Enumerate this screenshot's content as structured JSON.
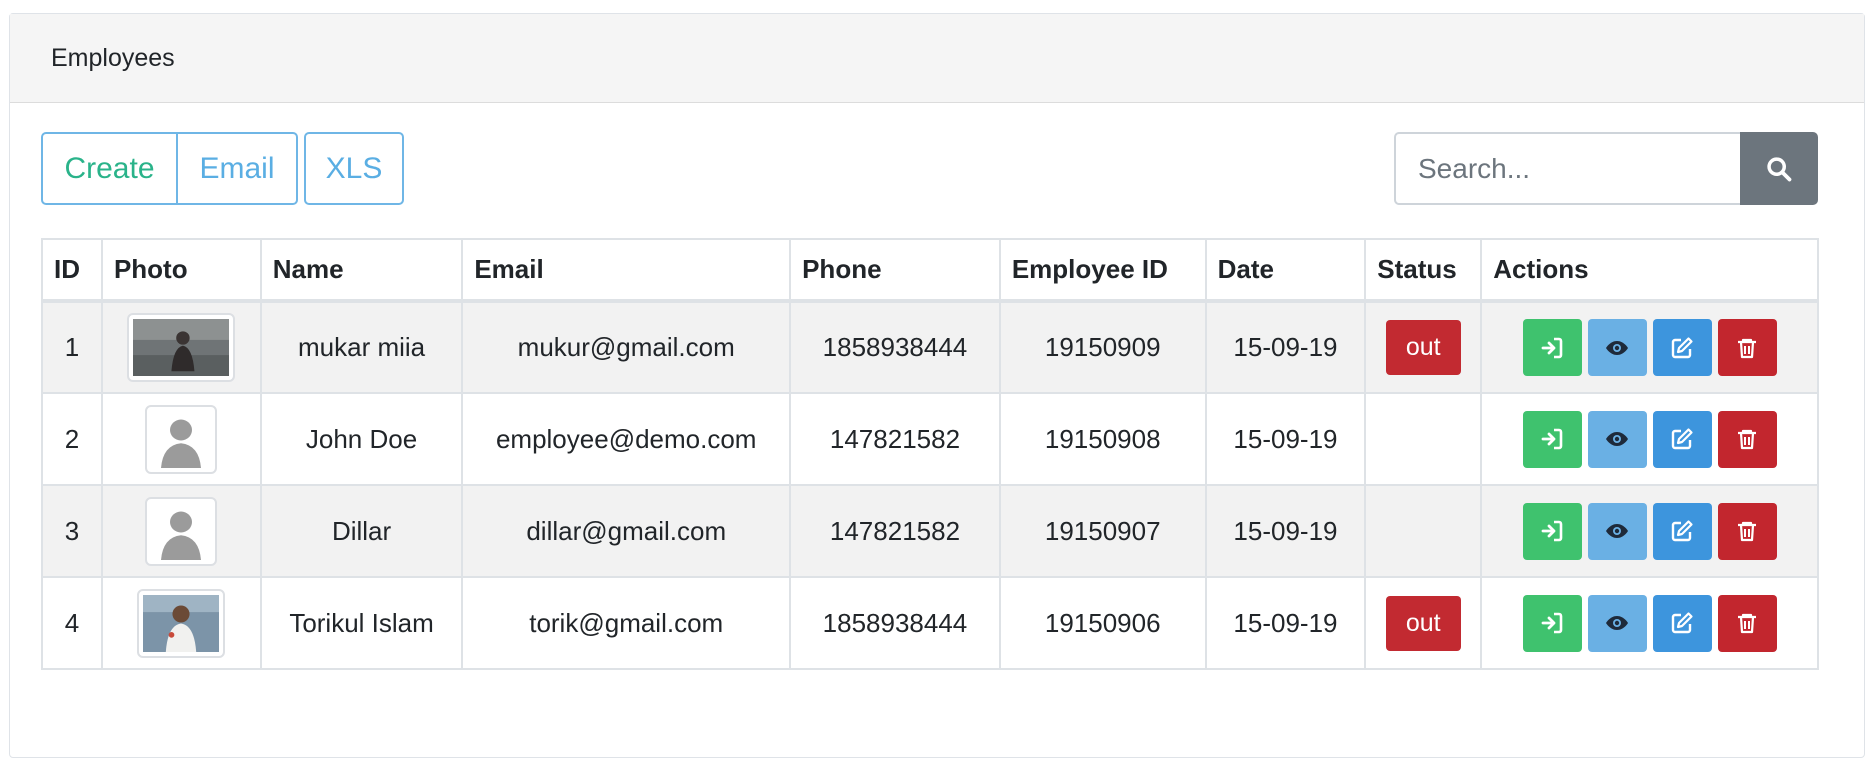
{
  "card": {
    "title": "Employees"
  },
  "toolbar": {
    "create_label": "Create",
    "email_label": "Email",
    "xls_label": "XLS"
  },
  "search": {
    "placeholder": "Search...",
    "icon": "search-icon"
  },
  "table": {
    "columns": [
      "ID",
      "Photo",
      "Name",
      "Email",
      "Phone",
      "Employee ID",
      "Date",
      "Status",
      "Actions"
    ],
    "rows": [
      {
        "id": "1",
        "photo": "person-photo",
        "name": "mukar miia",
        "email": "mukur@gmail.com",
        "phone": "1858938444",
        "employee_id": "19150909",
        "date": "15-09-19",
        "status": "out"
      },
      {
        "id": "2",
        "photo": "avatar-placeholder",
        "name": "John Doe",
        "email": "employee@demo.com",
        "phone": "147821582",
        "employee_id": "19150908",
        "date": "15-09-19",
        "status": ""
      },
      {
        "id": "3",
        "photo": "avatar-placeholder",
        "name": "Dillar",
        "email": "dillar@gmail.com",
        "phone": "147821582",
        "employee_id": "19150907",
        "date": "15-09-19",
        "status": ""
      },
      {
        "id": "4",
        "photo": "person-photo",
        "name": "Torikul Islam",
        "email": "torik@gmail.com",
        "phone": "1858938444",
        "employee_id": "19150906",
        "date": "15-09-19",
        "status": "out"
      }
    ],
    "action_icons": [
      "sign-in-icon",
      "eye-icon",
      "edit-icon",
      "trash-icon"
    ]
  },
  "colors": {
    "status_out": "#c22a31",
    "btn_login": "#3fc26e",
    "btn_view": "#6ab0e4",
    "btn_edit": "#3d95dd",
    "btn_delete": "#c2262e",
    "search_button": "#6c757d"
  }
}
